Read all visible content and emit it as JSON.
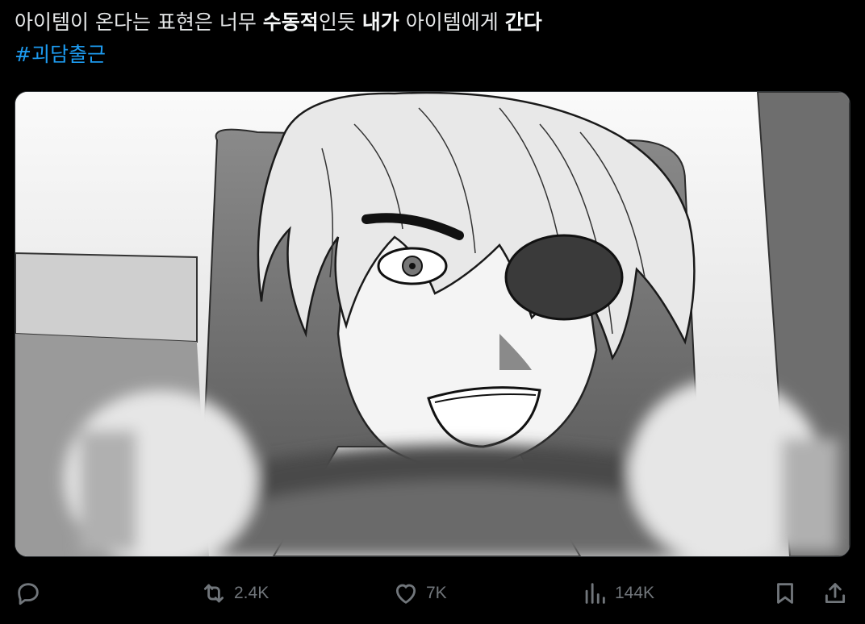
{
  "tweet": {
    "text_segments": [
      {
        "text": "아이템이 온다는 표현은 너무 ",
        "bold": false
      },
      {
        "text": "수동적",
        "bold": true
      },
      {
        "text": "인듯 ",
        "bold": false
      },
      {
        "text": "내가",
        "bold": true
      },
      {
        "text": " 아이템에게 ",
        "bold": false
      },
      {
        "text": "간다",
        "bold": true
      }
    ],
    "hashtag": "#괴담출근"
  },
  "media": {
    "icon": "manga-panel-image"
  },
  "actions": {
    "reply": {
      "icon": "reply-icon",
      "count": ""
    },
    "retweet": {
      "icon": "retweet-icon",
      "count": "2.4K"
    },
    "like": {
      "icon": "heart-icon",
      "count": "7K"
    },
    "views": {
      "icon": "views-chart-icon",
      "count": "144K"
    },
    "bookmark": {
      "icon": "bookmark-icon"
    },
    "share": {
      "icon": "share-icon"
    }
  },
  "colors": {
    "background": "#000000",
    "text": "#e7e9ea",
    "link": "#1d9bf0",
    "muted": "#71767b"
  }
}
